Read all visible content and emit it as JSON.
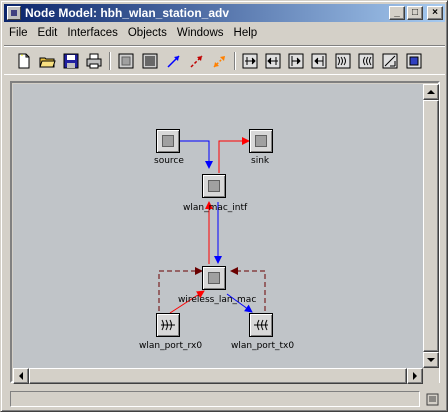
{
  "window": {
    "title": "Node Model: hbh_wlan_station_adv",
    "controls": {
      "minimize": "_",
      "maximize": "□",
      "close": "×"
    }
  },
  "menu": [
    "File",
    "Edit",
    "Interfaces",
    "Objects",
    "Windows",
    "Help"
  ],
  "toolbar": {
    "buttons": [
      "new-document-icon",
      "open-folder-icon",
      "save-icon",
      "print-icon",
      "processor-icon",
      "queue-icon",
      "packet-stream-icon",
      "statistic-wire-icon",
      "association-icon",
      "point-to-point-rx-icon",
      "point-to-point-tx-icon",
      "bus-rx-icon",
      "bus-tx-icon",
      "radio-rx-icon",
      "radio-tx-icon",
      "antenna-icon",
      "external-system-icon"
    ]
  },
  "nodes": {
    "source": "source",
    "sink": "sink",
    "wlan_mac_intf": "wlan_mac_intf",
    "wireless_lan_mac": "wireless_lan_mac",
    "wlan_port_rx0": "wlan_port_rx0",
    "wlan_port_tx0": "wlan_port_tx0"
  },
  "colors": {
    "stream_down": "#0000ff",
    "stream_up": "#ff0000",
    "statwire": "#6a0000"
  }
}
